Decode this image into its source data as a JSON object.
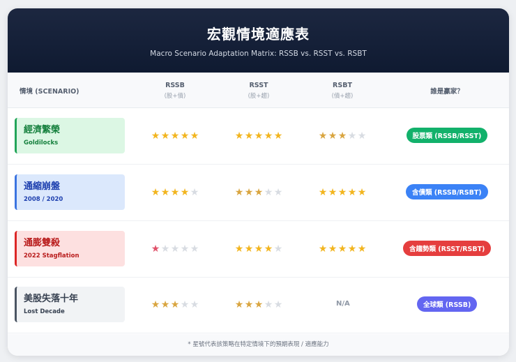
{
  "header": {
    "title": "宏觀情境適應表",
    "subtitle": "Macro Scenario Adaptation Matrix: RSSB vs. RSST vs. RSBT"
  },
  "columns": {
    "scenario": "情境 (SCENARIO)",
    "rssb": {
      "label": "RSSB",
      "sub": "(股+債)"
    },
    "rsst": {
      "label": "RSST",
      "sub": "(股+趨)"
    },
    "rsbt": {
      "label": "RSBT",
      "sub": "(債+趨)"
    },
    "winner": "誰是贏家？"
  },
  "rows": [
    {
      "zh": "經濟繁榮",
      "en": "Goldilocks",
      "theme": {
        "bg": "#dcf7e4",
        "border": "#22a559",
        "text": "#15803d"
      },
      "rssb": 5,
      "rsst": 5,
      "rsbt": 3,
      "winner": "股票類 (RSSB/RSST)",
      "badge_color": "#12b16b"
    },
    {
      "zh": "通縮崩盤",
      "en": "2008 / 2020",
      "theme": {
        "bg": "#dbe8fc",
        "border": "#3b74e0",
        "text": "#1e40af"
      },
      "rssb": 4,
      "rsst": 3,
      "rsbt": 5,
      "winner": "含債類 (RSSB/RSBT)",
      "badge_color": "#3b82f6"
    },
    {
      "zh": "通膨雙殺",
      "en": "2022 Stagflation",
      "theme": {
        "bg": "#fde0e0",
        "border": "#dc2626",
        "text": "#b91c1c"
      },
      "rssb": 1,
      "rsst": 4,
      "rsbt": 5,
      "winner": "含趨勢類 (RSST/RSBT)",
      "badge_color": "#e53e3e"
    },
    {
      "zh": "美股失落十年",
      "en": "Lost Decade",
      "theme": {
        "bg": "#f1f3f5",
        "border": "#4b5563",
        "text": "#374151"
      },
      "rssb": 3,
      "rsst": 3,
      "rsbt": "N/A",
      "winner": "全球類 (RSSB)",
      "badge_color": "#6366f1"
    }
  ],
  "star_glyph": "★",
  "star_colors": {
    "filled": "#f2b51f",
    "filled_low": "#d9a540",
    "danger": "#e0526a",
    "empty": "#d8dce2"
  },
  "footer": "* 星號代表該策略在特定情境下的預期表現 / 適應能力"
}
